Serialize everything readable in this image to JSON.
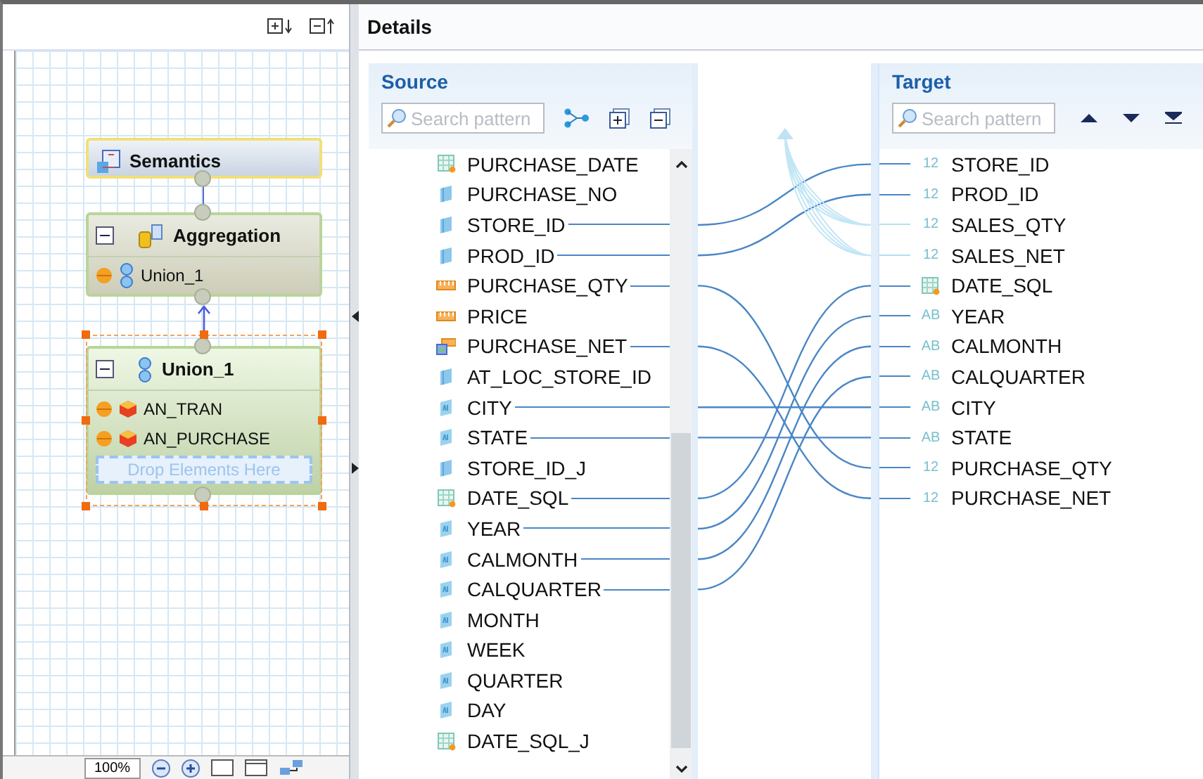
{
  "diagram": {
    "nodes": [
      {
        "title": "Semantics",
        "kind": "semantics",
        "selected": false
      },
      {
        "title": "Aggregation",
        "kind": "aggregation",
        "selected": false,
        "items": [
          {
            "label": "Union_1",
            "kind": "union"
          }
        ]
      },
      {
        "title": "Union_1",
        "kind": "union",
        "selected": true,
        "items": [
          {
            "label": "AN_TRAN",
            "kind": "cube"
          },
          {
            "label": "AN_PURCHASE",
            "kind": "cube"
          }
        ],
        "drop_hint": "Drop Elements Here"
      }
    ],
    "zoom": "100%"
  },
  "details": {
    "title": "Details",
    "source": {
      "title": "Source",
      "search": {
        "placeholder": "Search pattern"
      },
      "items": [
        {
          "name": "PURCHASE_DATE",
          "kind": "date",
          "mapped": false
        },
        {
          "name": "PURCHASE_NO",
          "kind": "attribute",
          "mapped": false
        },
        {
          "name": "STORE_ID",
          "kind": "attribute",
          "mapped": true
        },
        {
          "name": "PROD_ID",
          "kind": "attribute",
          "mapped": true
        },
        {
          "name": "PURCHASE_QTY",
          "kind": "measure",
          "mapped": true
        },
        {
          "name": "PRICE",
          "kind": "measure",
          "mapped": false
        },
        {
          "name": "PURCHASE_NET",
          "kind": "calculated",
          "mapped": true
        },
        {
          "name": "AT_LOC_STORE_ID",
          "kind": "attribute",
          "mapped": false
        },
        {
          "name": "CITY",
          "kind": "text",
          "mapped": true
        },
        {
          "name": "STATE",
          "kind": "text",
          "mapped": true
        },
        {
          "name": "STORE_ID_J",
          "kind": "attribute",
          "mapped": false
        },
        {
          "name": "DATE_SQL",
          "kind": "date",
          "mapped": true
        },
        {
          "name": "YEAR",
          "kind": "text",
          "mapped": true
        },
        {
          "name": "CALMONTH",
          "kind": "text",
          "mapped": true
        },
        {
          "name": "CALQUARTER",
          "kind": "text",
          "mapped": true
        },
        {
          "name": "MONTH",
          "kind": "text",
          "mapped": false
        },
        {
          "name": "WEEK",
          "kind": "text",
          "mapped": false
        },
        {
          "name": "QUARTER",
          "kind": "text",
          "mapped": false
        },
        {
          "name": "DAY",
          "kind": "text",
          "mapped": false
        },
        {
          "name": "DATE_SQL_J",
          "kind": "date",
          "mapped": false
        }
      ]
    },
    "target": {
      "title": "Target",
      "search": {
        "placeholder": "Search pattern"
      },
      "items": [
        {
          "name": "STORE_ID",
          "kind": "number",
          "type_label": "12",
          "mapped": true
        },
        {
          "name": "PROD_ID",
          "kind": "number",
          "type_label": "12",
          "mapped": true
        },
        {
          "name": "SALES_QTY",
          "kind": "number",
          "type_label": "12",
          "mapped": false
        },
        {
          "name": "SALES_NET",
          "kind": "number",
          "type_label": "12",
          "mapped": false
        },
        {
          "name": "DATE_SQL",
          "kind": "date",
          "mapped": true
        },
        {
          "name": "YEAR",
          "kind": "text",
          "type_label": "AB",
          "mapped": true
        },
        {
          "name": "CALMONTH",
          "kind": "text",
          "type_label": "AB",
          "mapped": true
        },
        {
          "name": "CALQUARTER",
          "kind": "text",
          "type_label": "AB",
          "mapped": true
        },
        {
          "name": "CITY",
          "kind": "text",
          "type_label": "AB",
          "mapped": true
        },
        {
          "name": "STATE",
          "kind": "text",
          "type_label": "AB",
          "mapped": true
        },
        {
          "name": "PURCHASE_QTY",
          "kind": "number",
          "type_label": "12",
          "mapped": true
        },
        {
          "name": "PURCHASE_NET",
          "kind": "number",
          "type_label": "12",
          "mapped": true
        }
      ]
    }
  }
}
